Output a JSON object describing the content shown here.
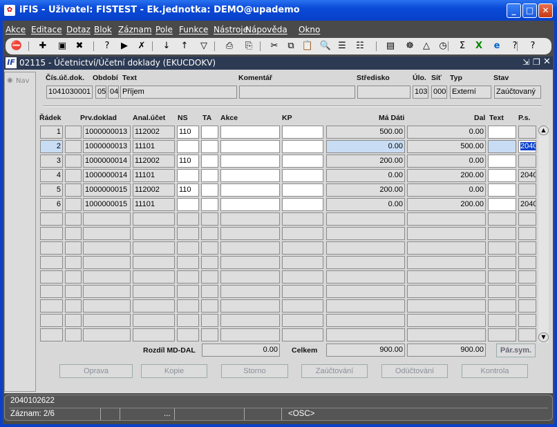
{
  "window": {
    "title": "iFIS - Uživatel: FISTEST - Ek.jednotka: DEMO@upademo",
    "app_icon": "ifis-icon",
    "controls": [
      "minimize",
      "maximize",
      "close"
    ]
  },
  "menu": [
    "Akce",
    "Editace",
    "Dotaz",
    "Blok",
    "Záznam",
    "Pole",
    "Funkce",
    "Nástroje",
    "Nápověda",
    "Okno"
  ],
  "toolbar": [
    "exit-icon",
    "insert-record-icon",
    "save-icon",
    "delete-record-icon",
    "query-enter-icon",
    "query-execute-icon",
    "query-cancel-icon",
    "sort-asc-icon",
    "sort-desc-icon",
    "filter-icon",
    "print-icon",
    "print-setup-icon",
    "cut-icon",
    "copy-icon",
    "paste-icon",
    "find-icon",
    "expand-icon",
    "collapse-icon",
    "form-icon",
    "settings-icon",
    "warning-icon",
    "clock-icon",
    "sum-icon",
    "excel-icon",
    "browser-icon",
    "help-icon",
    "context-help-icon"
  ],
  "form": {
    "title": "02115 - Účetnictví/Účetní doklady (EKUCDOKV)",
    "icon": "if-icon",
    "nav_label": "Nav"
  },
  "header": {
    "labels": [
      "Čís.úč.dok.",
      "Období",
      "Text",
      "Komentář",
      "Středisko",
      "Úlo.",
      "Síť",
      "Typ",
      "Stav"
    ],
    "values": {
      "cislo": "1041030001",
      "obdobi1": "05",
      "obdobi2": "04",
      "text": "Příjem",
      "komentar": "",
      "stredisko": "",
      "ulo": "103",
      "sit": "000",
      "typ": "Externí",
      "stav": "Zaúčtovaný"
    }
  },
  "grid": {
    "columns": [
      "Řádek",
      "Prv.doklad",
      "Anal.účet",
      "NS",
      "TA",
      "Akce",
      "KP",
      "Má Dáti",
      "Dal",
      "Text",
      "P.s."
    ],
    "rows": [
      {
        "radek": "1",
        "prv": "1000000013",
        "anal": "112002",
        "ns": "110",
        "ta": "",
        "akce": "",
        "kp": "",
        "md": "500.00",
        "dal": "0.00",
        "text": "",
        "ps": ""
      },
      {
        "radek": "2",
        "prv": "1000000013",
        "anal": "11101",
        "ns": "",
        "ta": "",
        "akce": "",
        "kp": "",
        "md": "0.00",
        "dal": "500.00",
        "text": "",
        "ps": "2040"
      },
      {
        "radek": "3",
        "prv": "1000000014",
        "anal": "112002",
        "ns": "110",
        "ta": "",
        "akce": "",
        "kp": "",
        "md": "200.00",
        "dal": "0.00",
        "text": "",
        "ps": ""
      },
      {
        "radek": "4",
        "prv": "1000000014",
        "anal": "11101",
        "ns": "",
        "ta": "",
        "akce": "",
        "kp": "",
        "md": "0.00",
        "dal": "200.00",
        "text": "",
        "ps": "2040"
      },
      {
        "radek": "5",
        "prv": "1000000015",
        "anal": "112002",
        "ns": "110",
        "ta": "",
        "akce": "",
        "kp": "",
        "md": "200.00",
        "dal": "0.00",
        "text": "",
        "ps": ""
      },
      {
        "radek": "6",
        "prv": "1000000015",
        "anal": "11101",
        "ns": "",
        "ta": "",
        "akce": "",
        "kp": "",
        "md": "0.00",
        "dal": "200.00",
        "text": "",
        "ps": "2040"
      }
    ],
    "empty_rows": 9,
    "selected_row": 2
  },
  "totals": {
    "rozdil_label": "Rozdíl MD-DAL",
    "rozdil": "0.00",
    "celkem_label": "Celkem",
    "md": "900.00",
    "dal": "900.00",
    "par_sym": "Pár.sym."
  },
  "buttons": [
    "Oprava",
    "Kopie",
    "Storno",
    "Zaúčtování",
    "Odúčtování",
    "Kontrola"
  ],
  "status": {
    "message": "2040102622",
    "record": "Záznam: 2/6",
    "ellipsis": "...",
    "mode": "<OSC>"
  }
}
